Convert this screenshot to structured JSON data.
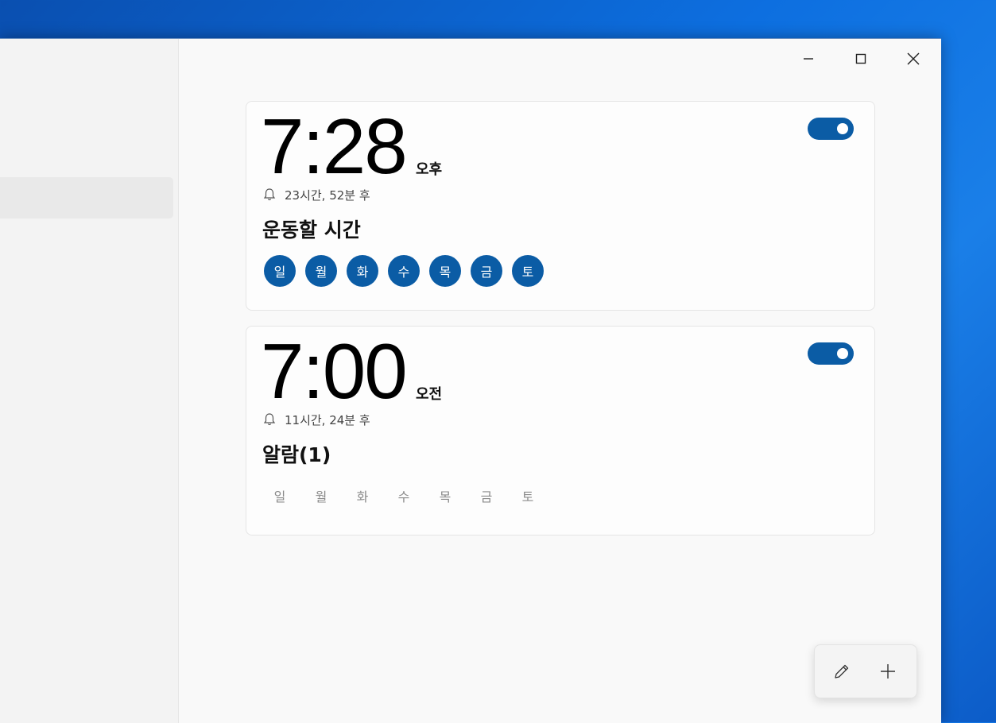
{
  "window_controls": {
    "minimize": "minimize-icon",
    "maximize": "maximize-icon",
    "close": "close-icon"
  },
  "alarms": [
    {
      "time": "7:28",
      "period": "오후",
      "remaining": "23시간, 52분 후",
      "name": "운동할 시간",
      "enabled": true,
      "days": [
        {
          "label": "일",
          "active": true
        },
        {
          "label": "월",
          "active": true
        },
        {
          "label": "화",
          "active": true
        },
        {
          "label": "수",
          "active": true
        },
        {
          "label": "목",
          "active": true
        },
        {
          "label": "금",
          "active": true
        },
        {
          "label": "토",
          "active": true
        }
      ]
    },
    {
      "time": "7:00",
      "period": "오전",
      "remaining": "11시간, 24분 후",
      "name": "알람(1)",
      "enabled": true,
      "days": [
        {
          "label": "일",
          "active": false
        },
        {
          "label": "월",
          "active": false
        },
        {
          "label": "화",
          "active": false
        },
        {
          "label": "수",
          "active": false
        },
        {
          "label": "목",
          "active": false
        },
        {
          "label": "금",
          "active": false
        },
        {
          "label": "토",
          "active": false
        }
      ]
    }
  ],
  "actions": {
    "edit": "pencil-icon",
    "add": "plus-icon"
  },
  "colors": {
    "accent": "#0b5ca5",
    "desktop": "#0d6fe0"
  }
}
